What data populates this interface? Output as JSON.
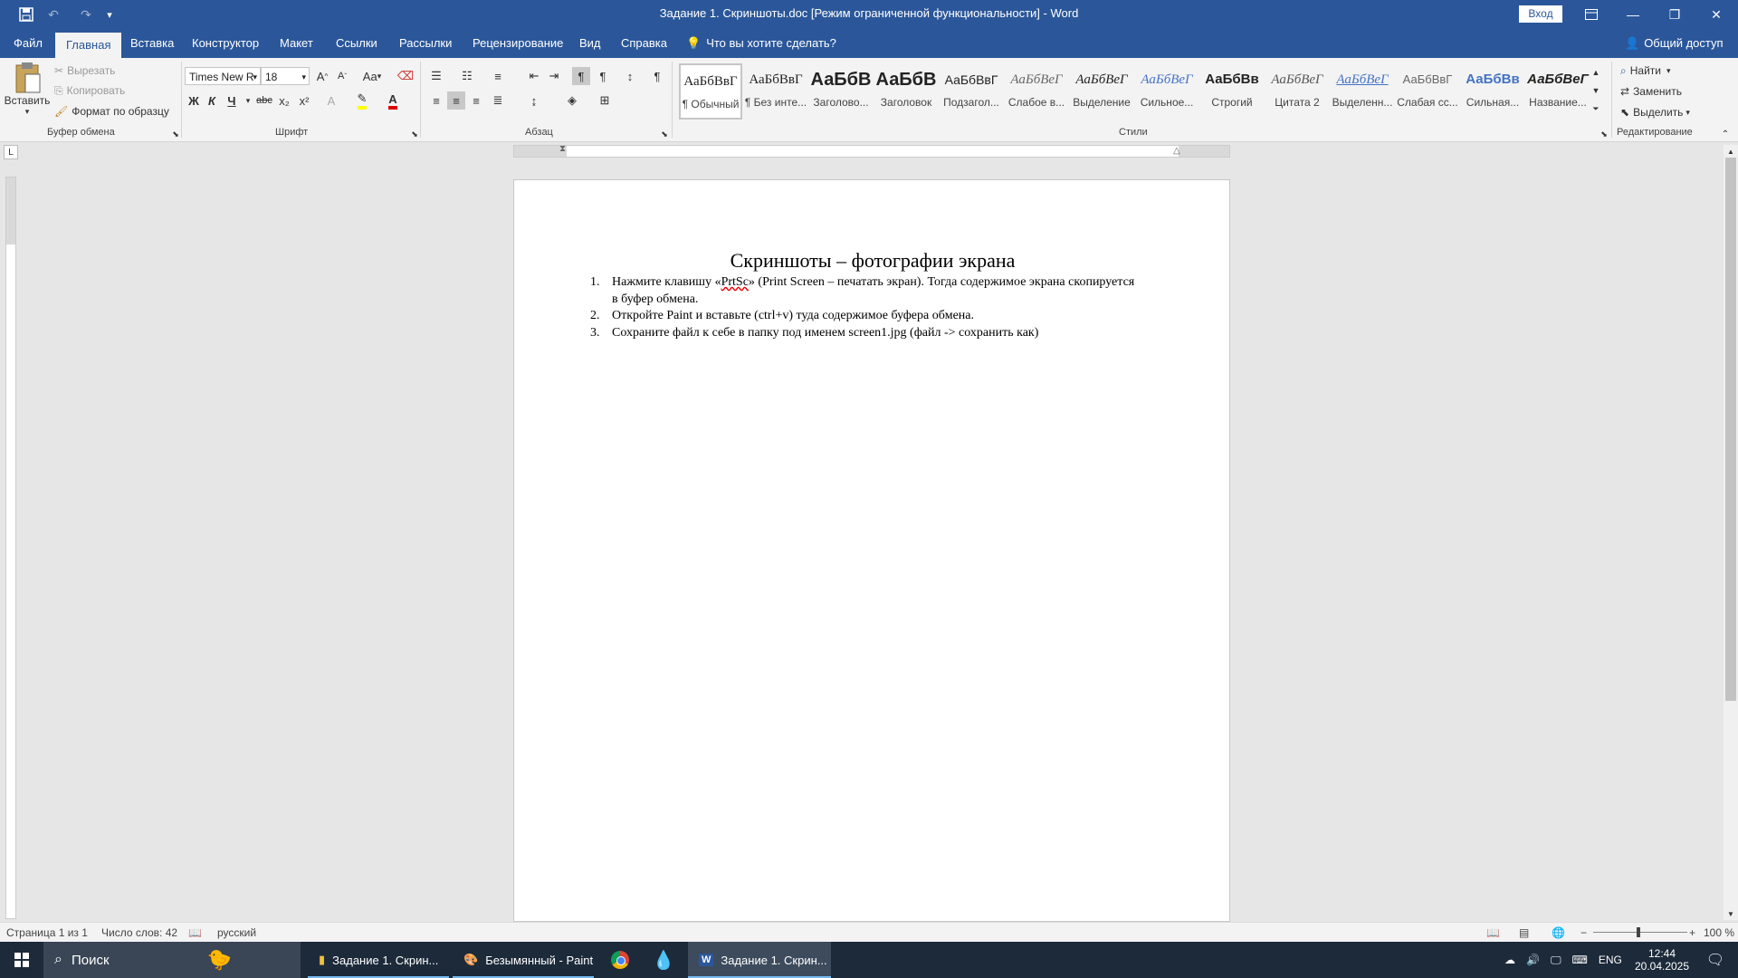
{
  "window": {
    "title": "Задание 1. Скриншоты.doc [Режим ограниченной функциональности]  -  Word",
    "signin": "Вход"
  },
  "tabs": [
    {
      "label": "Файл"
    },
    {
      "label": "Главная"
    },
    {
      "label": "Вставка"
    },
    {
      "label": "Конструктор"
    },
    {
      "label": "Макет"
    },
    {
      "label": "Ссылки"
    },
    {
      "label": "Рассылки"
    },
    {
      "label": "Рецензирование"
    },
    {
      "label": "Вид"
    },
    {
      "label": "Справка"
    }
  ],
  "tellme": "Что вы хотите сделать?",
  "share": "Общий доступ",
  "clipboard": {
    "paste": "Вставить",
    "cut": "Вырезать",
    "copy": "Копировать",
    "format_painter": "Формат по образцу",
    "label": "Буфер обмена"
  },
  "font": {
    "name": "Times New R",
    "size": "18",
    "label": "Шрифт",
    "bold": "Ж",
    "italic": "К",
    "underline": "Ч",
    "strike": "abc",
    "sub": "x₂",
    "sup": "x²",
    "case": "Aa"
  },
  "paragraph": {
    "label": "Абзац"
  },
  "styles": {
    "label": "Стили",
    "items": [
      {
        "sample": "АаБбВвГ",
        "label": "¶ Обычный"
      },
      {
        "sample": "АаБбВвГ",
        "label": "¶ Без инте..."
      },
      {
        "sample": "АаБбВ",
        "label": "Заголово..."
      },
      {
        "sample": "АаБбВ",
        "label": "Заголовок"
      },
      {
        "sample": "АаБбВвГ",
        "label": "Подзагол..."
      },
      {
        "sample": "АаБбВеГ",
        "label": "Слабое в..."
      },
      {
        "sample": "АаБбВеГ",
        "label": "Выделение"
      },
      {
        "sample": "АаБбВеГ",
        "label": "Сильное..."
      },
      {
        "sample": "АаБбВв",
        "label": "Строгий"
      },
      {
        "sample": "АаБбВеГ",
        "label": "Цитата 2"
      },
      {
        "sample": "АаБбВеГ",
        "label": "Выделенн..."
      },
      {
        "sample": "АаБбВвГ",
        "label": "Слабая сс..."
      },
      {
        "sample": "АаБбВв",
        "label": "Сильная..."
      },
      {
        "sample": "АаБбВеГ",
        "label": "Название..."
      }
    ]
  },
  "editing": {
    "find": "Найти",
    "replace": "Заменить",
    "select": "Выделить",
    "label": "Редактирование"
  },
  "document": {
    "heading": "Скриншоты – фотографии экрана",
    "items": [
      {
        "num": "1.",
        "pre": "Нажмите клавишу «",
        "spell": "PrtSc",
        "post": "» (Print Screen – печатать экран). Тогда содержимое экрана скопируется в буфер обмена."
      },
      {
        "num": "2.",
        "text": "Откройте Paint и вставьте (ctrl+v) туда содержимое буфера обмена."
      },
      {
        "num": "3.",
        "text": "Сохраните файл к себе в папку под именем screen1.jpg (файл -> сохранить как)"
      }
    ]
  },
  "status": {
    "page": "Страница 1 из 1",
    "words": "Число слов: 42",
    "lang": "русский",
    "zoom": "100 %"
  },
  "taskbar": {
    "search": "Поиск",
    "apps": [
      {
        "label": "Задание 1. Скрин..."
      },
      {
        "label": "Безымянный - Paint"
      },
      {
        "label": "Задание 1. Скрин..."
      }
    ],
    "lang": "ENG",
    "time": "12:44",
    "date": "20.04.2025"
  },
  "colors": {
    "word_blue": "#2b579a",
    "ribbon": "#f3f3f3",
    "taskbar": "#1c2a3a"
  }
}
